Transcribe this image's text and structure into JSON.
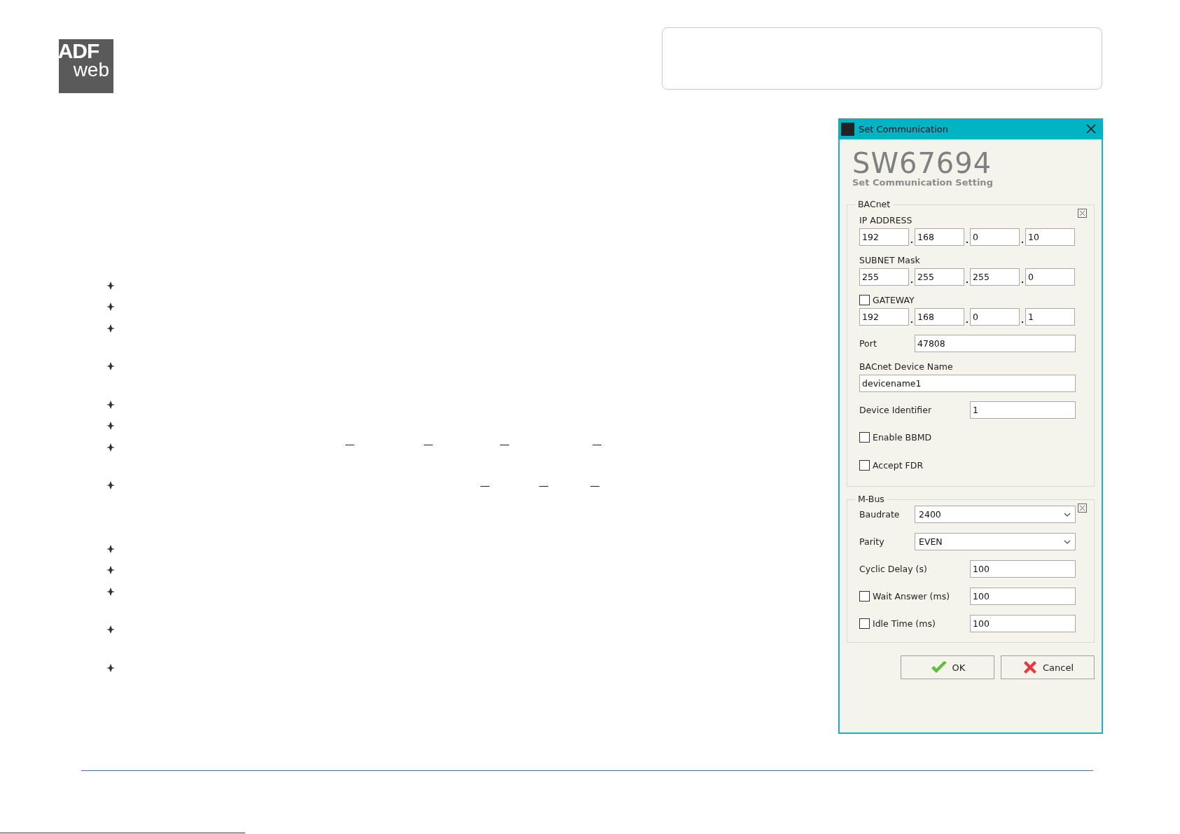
{
  "logo": {
    "line1": "ADF",
    "line2": "web"
  },
  "dialog": {
    "title": "Set Communication",
    "heading": "SW67694",
    "subheading": "Set Communication Setting",
    "groups": [
      {
        "title": "BACnet",
        "rows": [
          {
            "kind": "ip",
            "label": "IP ADDRESS",
            "values": [
              "192",
              "168",
              "0",
              "10"
            ]
          },
          {
            "kind": "ip",
            "label": "SUBNET Mask",
            "values": [
              "255",
              "255",
              "255",
              "0"
            ]
          },
          {
            "kind": "ip",
            "label": "GATEWAY",
            "checked": false,
            "values": [
              "192",
              "168",
              "0",
              "1"
            ]
          },
          {
            "kind": "wide",
            "label": "Port",
            "value": "47808"
          },
          {
            "kind": "stacked",
            "label": "BACnet Device Name",
            "value": "devicename1"
          },
          {
            "kind": "field",
            "label": "Device Identifier",
            "value": "1"
          },
          {
            "kind": "check",
            "label": "Enable BBMD",
            "checked": false
          },
          {
            "kind": "check",
            "label": "Accept FDR",
            "checked": false
          }
        ]
      },
      {
        "title": "M-Bus",
        "rows": [
          {
            "kind": "select",
            "label": "Baudrate",
            "value": "2400"
          },
          {
            "kind": "select",
            "label": "Parity",
            "value": "EVEN"
          },
          {
            "kind": "field",
            "label": "Cyclic Delay (s)",
            "value": "100"
          },
          {
            "kind": "field",
            "label": "Wait Answer (ms)",
            "checked": false,
            "value": "100"
          },
          {
            "kind": "field",
            "label": "Idle Time (ms)",
            "checked": false,
            "value": "100"
          }
        ]
      }
    ],
    "buttons": [
      {
        "kind": "ok",
        "label": "OK"
      },
      {
        "kind": "cancel",
        "label": "Cancel"
      }
    ]
  }
}
